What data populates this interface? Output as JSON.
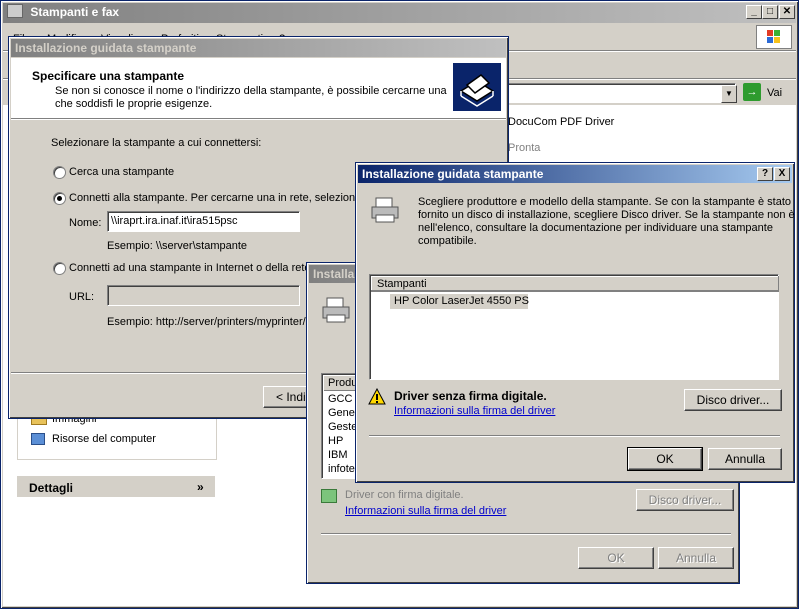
{
  "explorer": {
    "title": "Stampanti e fax",
    "menu": [
      "File",
      "Modifica",
      "Visualizza",
      "Preferiti",
      "Strumenti",
      "?"
    ],
    "go_label": "Vai",
    "printer_name": "DocuCom PDF Driver",
    "printer_status": "Pronta",
    "left_links": [
      "Immagini",
      "Risorse del computer"
    ],
    "details_label": "Dettagli"
  },
  "wizard": {
    "title": "Installazione guidata stampante",
    "header_title": "Specificare una stampante",
    "header_desc_1": "Se non si conosce il nome o l'indirizzo della stampante, è possibile cercarne una",
    "header_desc_2": "che soddisfi le proprie esigenze.",
    "prompt": "Selezionare la stampante a cui connettersi:",
    "opt_search": "Cerca una stampante",
    "opt_connect": "Connetti alla stampante. Per cercarne una in rete, selezionare",
    "name_label": "Nome:",
    "name_value": "\\\\iraprt.ira.inaf.it\\ira515psc",
    "example_unc": "Esempio: \\\\server\\stampante",
    "opt_internet": "Connetti ad una stampante in Internet o della rete c",
    "url_label": "URL:",
    "example_url": "Esempio: http://server/printers/myprinter/.",
    "back_button": "< Indie"
  },
  "mid_dialog": {
    "title": "Installaz",
    "list_header": "Produ",
    "manufacturers": [
      "GCC",
      "Gene",
      "Geste",
      "HP",
      "IBM",
      "infote"
    ],
    "signed_text": "Driver con firma digitale.",
    "sign_link": "Informazioni sulla firma del driver",
    "disk_button": "Disco driver...",
    "ok_button": "OK",
    "cancel_button": "Annulla"
  },
  "front_dialog": {
    "title": "Installazione guidata stampante",
    "help_btn": "?",
    "close_btn": "X",
    "desc_1": "Scegliere produttore e modello della stampante. Se con la stampante è stato",
    "desc_2": "fornito un disco di installazione, scegliere Disco driver. Se la stampante non è",
    "desc_3": "nell'elenco, consultare la documentazione per individuare una stampante",
    "desc_4": "compatibile.",
    "list_header": "Stampanti",
    "printers": [
      "HP Color LaserJet 4550 PS"
    ],
    "warn_text": "Driver senza firma digitale.",
    "sign_link": "Informazioni sulla firma del driver",
    "disk_button": "Disco driver...",
    "ok_button": "OK",
    "cancel_button": "Annulla"
  },
  "colors": {
    "title_active": "#0a246a",
    "title_inactive": "#808080",
    "selection": "#d4d0c8",
    "link": "#0000cc"
  }
}
